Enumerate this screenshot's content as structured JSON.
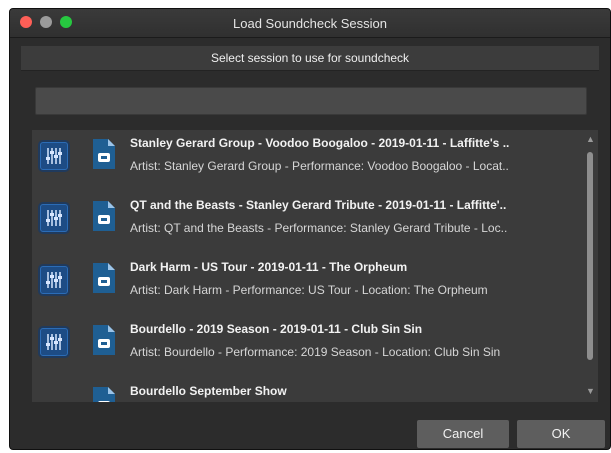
{
  "window": {
    "title": "Load Soundcheck Session"
  },
  "header": {
    "subtitle": "Select session to use for soundcheck"
  },
  "search": {
    "value": ""
  },
  "sessions": [
    {
      "name": "Stanley Gerard Group - Voodoo Boogaloo - 2019-01-11 - Laffitte's ..",
      "detail": "Artist: Stanley Gerard Group - Performance: Voodoo Boogaloo - Locat.."
    },
    {
      "name": "QT and the Beasts - Stanley Gerard Tribute - 2019-01-11 - Laffitte'..",
      "detail": "Artist: QT and the Beasts - Performance: Stanley Gerard Tribute - Loc.."
    },
    {
      "name": "Dark Harm - US Tour - 2019-01-11 - The Orpheum",
      "detail": "Artist: Dark Harm - Performance: US Tour - Location: The Orpheum"
    },
    {
      "name": "Bourdello - 2019 Season - 2019-01-11 - Club Sin Sin",
      "detail": "Artist: Bourdello - Performance: 2019 Season - Location: Club Sin Sin"
    },
    {
      "name": "Bourdello September Show",
      "detail": ""
    }
  ],
  "icons": {
    "mixer": "mixer-faders-icon",
    "session": "session-document-icon"
  },
  "buttons": {
    "cancel": "Cancel",
    "ok": "OK"
  },
  "colors": {
    "accent": "#1d4c85",
    "close": "#fe5f57",
    "zoom": "#27c840"
  }
}
